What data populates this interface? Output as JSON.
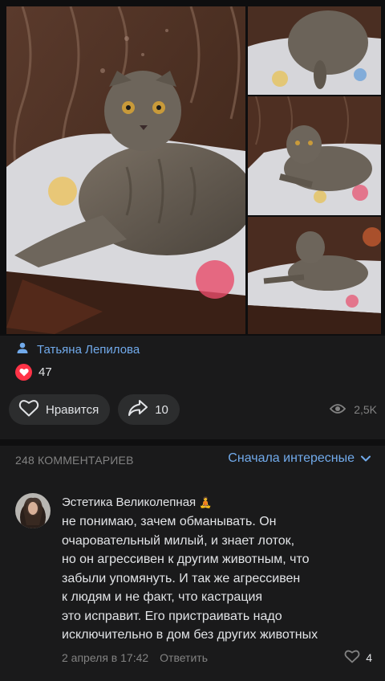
{
  "post": {
    "author": "Татьяна Лепилова",
    "like_count": "47",
    "like_button_label": "Нравится",
    "share_count": "10",
    "views": "2,5K"
  },
  "comments_header": {
    "count_label": "248 КОММЕНТАРИЕВ",
    "sort_label": "Сначала интересные"
  },
  "comment": {
    "author": "Эстетика Великолепная",
    "author_badge": "🧘",
    "lines": [
      "не понимаю, зачем обманывать. Он",
      "очаровательный милый, и знает лоток,",
      "но он агрессивен к другим животным, что",
      "забыли упомянуть. И так же агрессивен",
      "к людям и не факт, что кастрация",
      "это исправит. Его пристраивать надо",
      "исключительно в дом без других животных"
    ],
    "date": "2 апреля в 17:42",
    "reply_label": "Ответить",
    "likes": "4"
  },
  "colors": {
    "background": "#1a1a1b",
    "accent_link": "#71aaeb",
    "heart": "#ff3347",
    "muted": "#828282"
  },
  "icons": [
    "person-icon",
    "heart-icon",
    "like-icon",
    "share-icon",
    "eye-icon",
    "chevron-down-icon",
    "like-outline-icon"
  ]
}
